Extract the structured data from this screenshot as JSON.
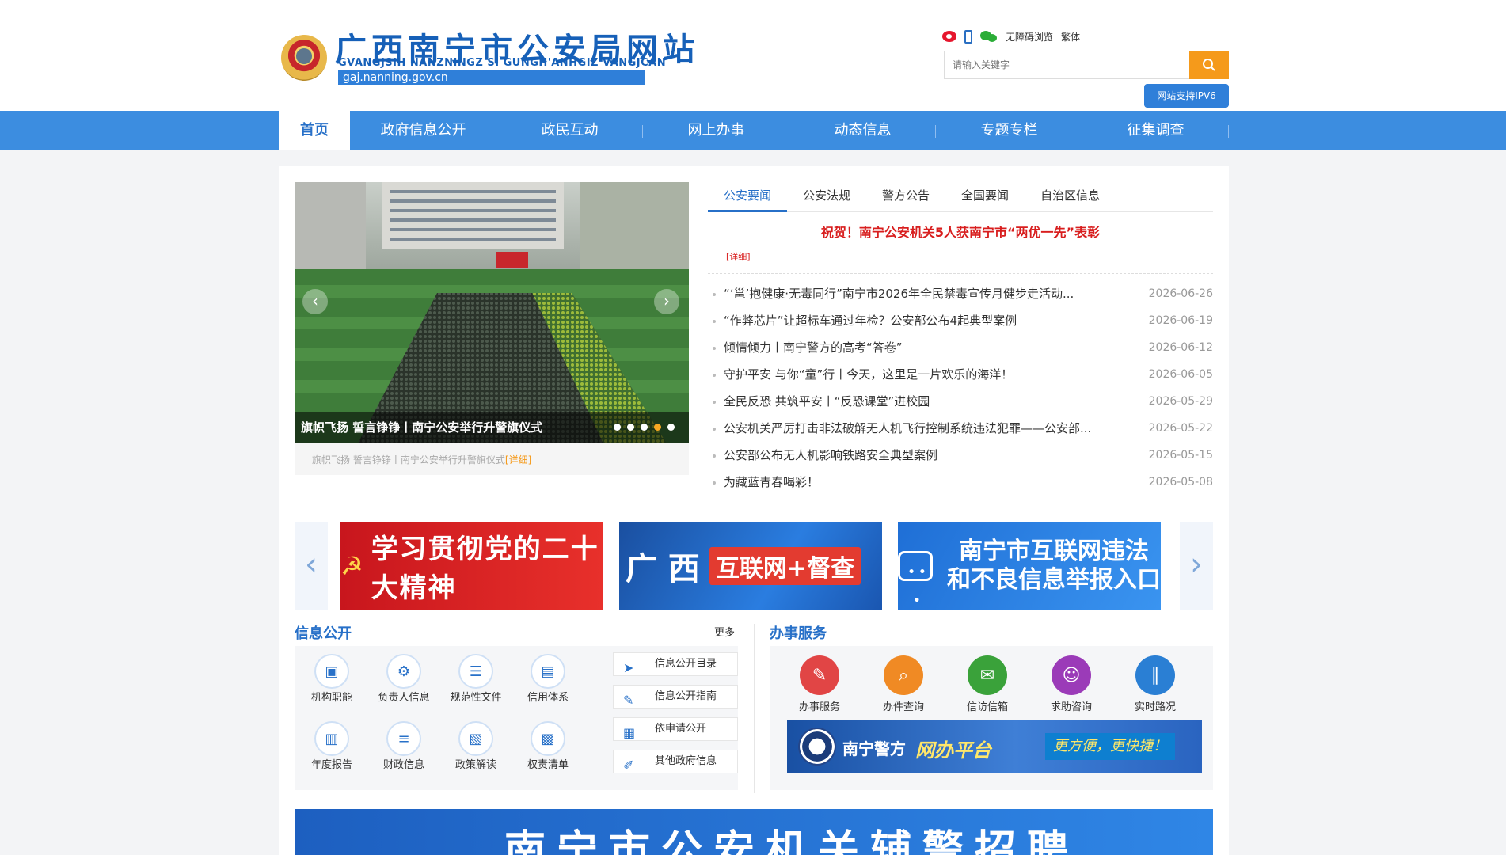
{
  "header": {
    "title": "广西南宁市公安局网站",
    "subtitle": "GVANGJSIH NANZNINGZ SI GUNGH'ANHGIZ VANGJCAN",
    "domain": "gaj.nanning.gov.cn",
    "accessible": "无障碍浏览",
    "traditional": "繁体",
    "search_placeholder": "请输入关键字",
    "ipv6": "网站支持IPV6"
  },
  "nav": [
    {
      "label": "首页",
      "active": true
    },
    {
      "label": "政府信息公开"
    },
    {
      "label": "政民互动"
    },
    {
      "label": "网上办事"
    },
    {
      "label": "动态信息"
    },
    {
      "label": "专题专栏"
    },
    {
      "label": "征集调查"
    }
  ],
  "carousel": {
    "caption": "旗帜飞扬 誓言铮铮丨南宁公安举行升警旗仪式",
    "sub_caption": "旗帜飞扬 誓言铮铮丨南宁公安举行升警旗仪式",
    "detail": "[详细]",
    "prev": "‹",
    "next": "›",
    "active_dot": 4,
    "dot_count": 5
  },
  "news": {
    "tabs": [
      "公安要闻",
      "公安法规",
      "警方公告",
      "全国要闻",
      "自治区信息"
    ],
    "headline": "祝贺！南宁公安机关5人获南宁市“两优一先”表彰",
    "headline_detail": "[详细]",
    "items": [
      {
        "title": "“‘邕’抱健康·无毒同行”南宁市2026年全民禁毒宣传月健步走活动...",
        "date": "2026-06-26"
      },
      {
        "title": "“作弊芯片”让超标车通过年检？公安部公布4起典型案例",
        "date": "2026-06-19"
      },
      {
        "title": "倾情倾力丨南宁警方的高考“答卷”",
        "date": "2026-06-12"
      },
      {
        "title": "守护平安 与你“童”行丨今天，这里是一片欢乐的海洋！",
        "date": "2026-06-05"
      },
      {
        "title": "全民反恐 共筑平安丨“反恐课堂”进校园",
        "date": "2026-05-29"
      },
      {
        "title": "公安机关严厉打击非法破解无人机飞行控制系统违法犯罪——公安部...",
        "date": "2026-05-22"
      },
      {
        "title": "公安部公布无人机影响铁路安全典型案例",
        "date": "2026-05-15"
      },
      {
        "title": "为藏蓝青春喝彩！",
        "date": "2026-05-08"
      }
    ]
  },
  "banners": {
    "prev": "‹",
    "next": "›",
    "red": "学习贯彻党的二十大精神",
    "blue1_main": "广 西",
    "blue1_tag": "互联网+督查",
    "blue2_line1": "南宁市互联网违法",
    "blue2_line2": "和不良信息举报入口"
  },
  "info": {
    "title": "信息公开",
    "more": "更多",
    "grid": [
      {
        "label": "机构职能",
        "icon": "▣"
      },
      {
        "label": "负责人信息",
        "icon": "⚙"
      },
      {
        "label": "规范性文件",
        "icon": "☰"
      },
      {
        "label": "信用体系",
        "icon": "▤"
      },
      {
        "label": "年度报告",
        "icon": "▥"
      },
      {
        "label": "财政信息",
        "icon": "≡"
      },
      {
        "label": "政策解读",
        "icon": "▧"
      },
      {
        "label": "权责清单",
        "icon": "▩"
      }
    ],
    "links": [
      {
        "label": "信息公开目录",
        "icon": "➤"
      },
      {
        "label": "信息公开指南",
        "icon": "✎"
      },
      {
        "label": "依申请公开",
        "icon": "▦"
      },
      {
        "label": "其他政府信息",
        "icon": "✐"
      }
    ]
  },
  "service": {
    "title": "办事服务",
    "items": [
      {
        "label": "办事服务",
        "color": "#e14545",
        "icon": "✎"
      },
      {
        "label": "办件查询",
        "color": "#f08a24",
        "icon": "⌕"
      },
      {
        "label": "信访信箱",
        "color": "#3aa23a",
        "icon": "✉"
      },
      {
        "label": "求助咨询",
        "color": "#9b3bb8",
        "icon": "☺"
      },
      {
        "label": "实时路况",
        "color": "#2a7fd4",
        "icon": "∥"
      }
    ],
    "police_name": "南宁警方",
    "police_slogan": "网办平台",
    "police_tag": "更方便，更快捷！"
  },
  "recruit": "南宁市公安机关辅警招聘"
}
